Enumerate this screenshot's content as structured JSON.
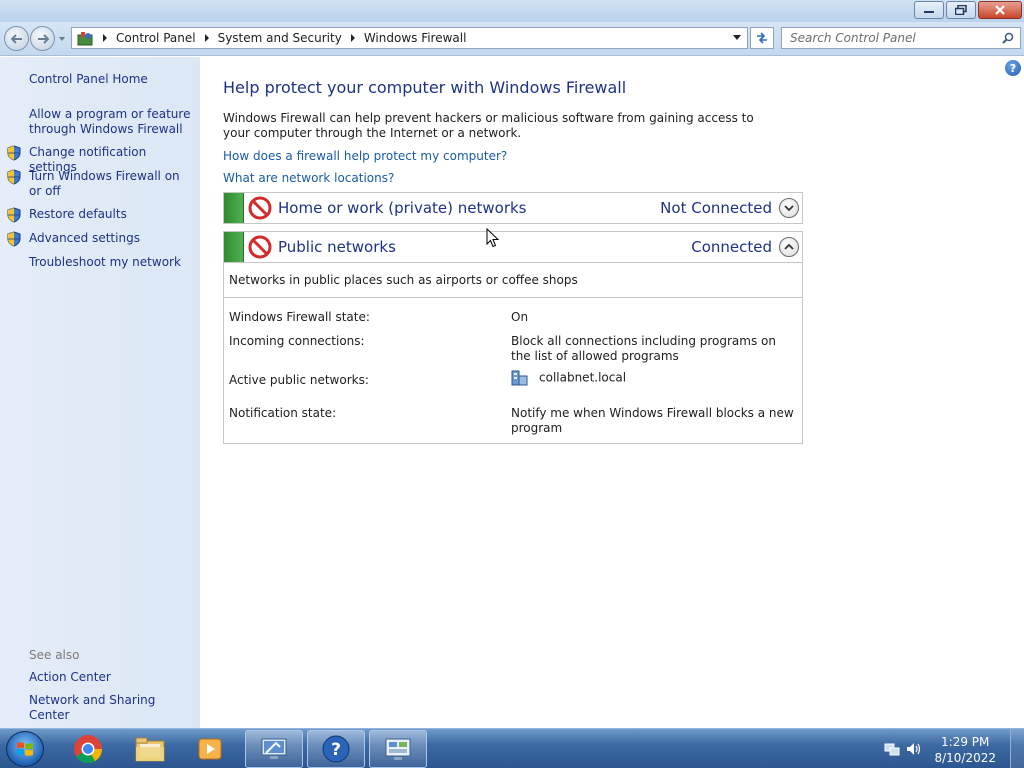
{
  "window": {
    "minimize_icon": "minimize-icon",
    "maximize_icon": "restore-icon",
    "close_icon": "close-icon"
  },
  "nav": {
    "breadcrumbs": [
      "Control Panel",
      "System and Security",
      "Windows Firewall"
    ],
    "search_placeholder": "Search Control Panel"
  },
  "sidebar": {
    "home": "Control Panel Home",
    "items": [
      {
        "label": "Allow a program or feature through Windows Firewall",
        "shield": false
      },
      {
        "label": "Change notification settings",
        "shield": true
      },
      {
        "label": "Turn Windows Firewall on or off",
        "shield": true
      },
      {
        "label": "Restore defaults",
        "shield": true
      },
      {
        "label": "Advanced settings",
        "shield": true
      },
      {
        "label": "Troubleshoot my network",
        "shield": false
      }
    ],
    "see_also": "See also",
    "see_also_links": [
      "Action Center",
      "Network and Sharing Center"
    ]
  },
  "main": {
    "title": "Help protect your computer with Windows Firewall",
    "intro": "Windows Firewall can help prevent hackers or malicious software from gaining access to your computer through the Internet or a network.",
    "links": [
      "How does a firewall help protect my computer?",
      "What are network locations?"
    ],
    "home_network": {
      "title": "Home or work (private) networks",
      "status": "Not Connected"
    },
    "public_network": {
      "title": "Public networks",
      "status": "Connected",
      "description": "Networks in public places such as airports or coffee shops",
      "details": [
        {
          "label": "Windows Firewall state:",
          "value": "On"
        },
        {
          "label": "Incoming connections:",
          "value": "Block all connections including programs on the list of allowed programs"
        },
        {
          "label": "Active public networks:",
          "value": "collabnet.local"
        },
        {
          "label": "Notification state:",
          "value": "Notify me when Windows Firewall blocks a new program"
        }
      ]
    }
  },
  "taskbar": {
    "time": "1:29 PM",
    "date": "8/10/2022"
  },
  "colors": {
    "link": "#1a5aa8",
    "heading": "#1e3287",
    "status_green": "#3c9a3c",
    "block_red": "#d22b2b"
  }
}
